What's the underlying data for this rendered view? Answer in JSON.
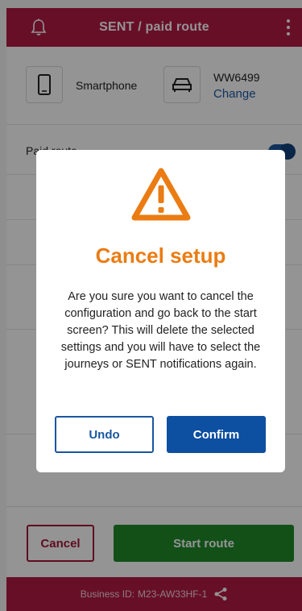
{
  "header": {
    "title": "SENT / paid route",
    "bell_icon": "bell-icon",
    "menu_icon": "kebab-menu-icon"
  },
  "device": {
    "device_label": "Smartphone",
    "device_icon": "smartphone-icon",
    "vehicle_icon": "car-icon",
    "plate": "WW6499",
    "change_label": "Change"
  },
  "settings": {
    "paid_route_label": "Paid route",
    "paid_route_toggle": true
  },
  "footer": {
    "cancel_label": "Cancel",
    "start_label": "Start route"
  },
  "bottom_bar": {
    "business_id_label": "Business ID:",
    "business_id": "M23-AW33HF-1",
    "share_icon": "share-icon"
  },
  "modal": {
    "icon": "warning-triangle-icon",
    "title": "Cancel setup",
    "body": "Are you sure you want to cancel the configuration and go back to the start screen? This will delete the selected settings and you will have to select the journeys or SENT notifications again.",
    "undo_label": "Undo",
    "confirm_label": "Confirm"
  },
  "colors": {
    "brand": "#b31b45",
    "accent_blue": "#0d4fa0",
    "warning_orange": "#ea7c13",
    "start_green": "#1f8a2a"
  }
}
